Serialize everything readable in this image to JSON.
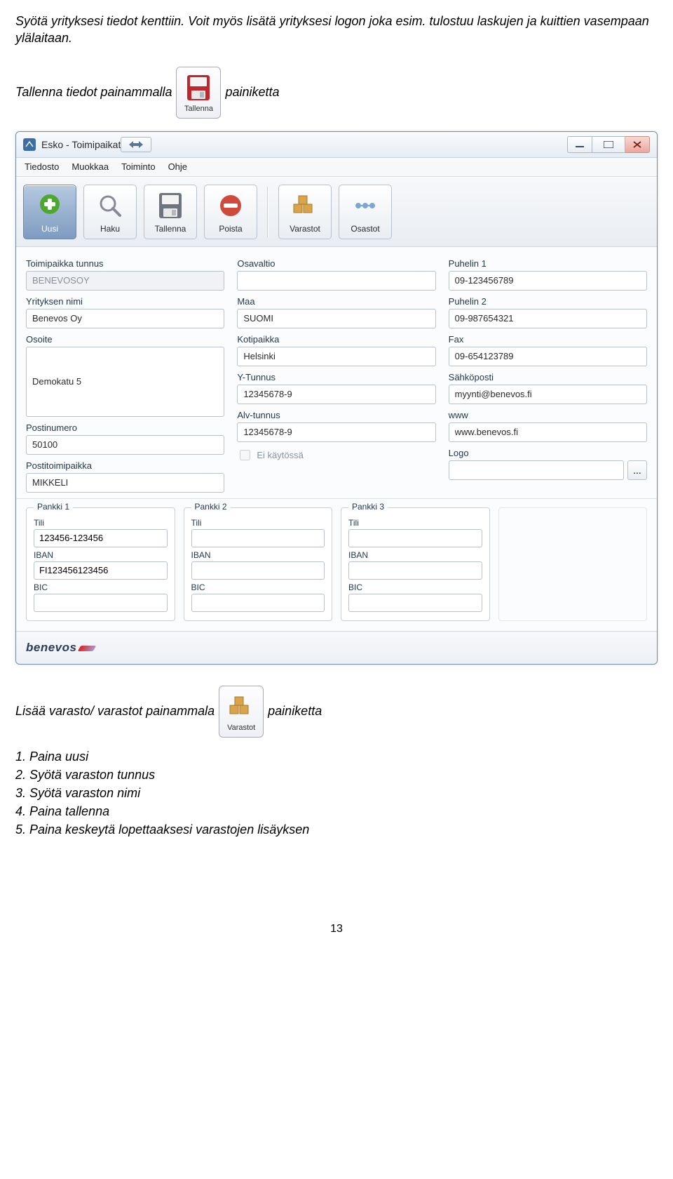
{
  "intro": "Syötä yrityksesi tiedot kenttiin. Voit myös lisätä yrityksesi logon joka esim. tulostuu laskujen ja kuittien vasempaan ylälaitaan.",
  "save_line": {
    "pre": "Tallenna tiedot painammalla",
    "post": "painiketta",
    "icon_label": "Tallenna"
  },
  "window": {
    "title": "Esko - Toimipaikat"
  },
  "menu": {
    "tiedosto": "Tiedosto",
    "muokkaa": "Muokkaa",
    "toiminto": "Toiminto",
    "ohje": "Ohje"
  },
  "toolbar": {
    "uusi": "Uusi",
    "haku": "Haku",
    "tallenna": "Tallenna",
    "poista": "Poista",
    "varastot": "Varastot",
    "osastot": "Osastot"
  },
  "labels": {
    "toimipaikka_tunnus": "Toimipaikka tunnus",
    "yrityksen_nimi": "Yrityksen nimi",
    "osoite": "Osoite",
    "postinumero": "Postinumero",
    "postitoimipaikka": "Postitoimipaikka",
    "osavaltio": "Osavaltio",
    "maa": "Maa",
    "kotipaikka": "Kotipaikka",
    "ytunnus": "Y-Tunnus",
    "alvtunnus": "Alv-tunnus",
    "eikaytossa": "Ei käytössä",
    "puhelin1": "Puhelin 1",
    "puhelin2": "Puhelin 2",
    "fax": "Fax",
    "sahkoposti": "Sähköposti",
    "www": "www",
    "logo": "Logo",
    "tili": "Tili",
    "iban": "IBAN",
    "bic": "BIC",
    "pankki1": "Pankki 1",
    "pankki2": "Pankki 2",
    "pankki3": "Pankki 3"
  },
  "values": {
    "toimipaikka_tunnus": "BENEVOSOY",
    "yrityksen_nimi": "Benevos Oy",
    "osoite": "Demokatu 5",
    "postinumero": "50100",
    "postitoimipaikka": "MIKKELI",
    "osavaltio": "",
    "maa": "SUOMI",
    "kotipaikka": "Helsinki",
    "ytunnus": "12345678-9",
    "alvtunnus": "12345678-9",
    "puhelin1": "09-123456789",
    "puhelin2": "09-987654321",
    "fax": "09-654123789",
    "sahkoposti": "myynti@benevos.fi",
    "www": "www.benevos.fi",
    "logo": "",
    "p1_tili": "123456-123456",
    "p1_iban": "FI123456123456",
    "p1_bic": "",
    "p2_tili": "",
    "p2_iban": "",
    "p2_bic": "",
    "p3_tili": "",
    "p3_iban": "",
    "p3_bic": ""
  },
  "footer_logo": "benevos",
  "varastot_line": {
    "pre": "Lisää varasto/ varastot painammala",
    "post": "painiketta",
    "icon_label": "Varastot"
  },
  "steps": {
    "s1": "1. Paina uusi",
    "s2": "2. Syötä varaston tunnus",
    "s3": "3. Syötä varaston nimi",
    "s4": "4. Paina tallenna",
    "s5": "5. Paina keskeytä lopettaaksesi varastojen lisäyksen"
  },
  "page_number": "13",
  "browse_btn": "..."
}
